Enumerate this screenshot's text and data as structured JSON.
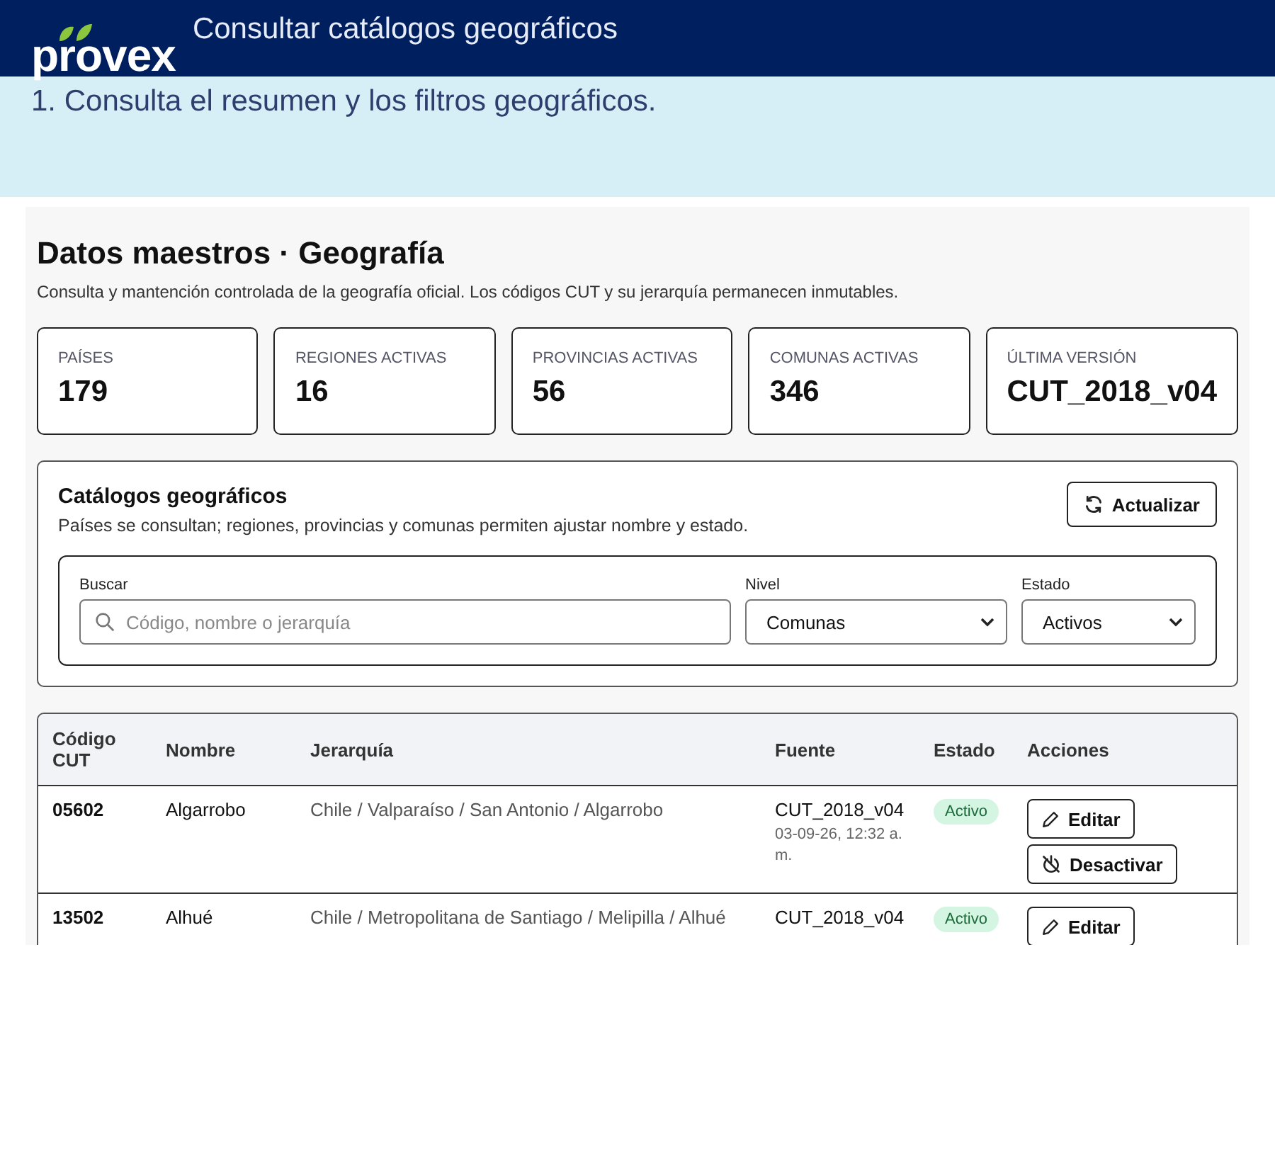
{
  "header": {
    "logo": "provex",
    "title": "Consultar catálogos geográficos"
  },
  "step": {
    "text": "1. Consulta el resumen y los filtros geográficos."
  },
  "page": {
    "title": "Datos maestros · Geografía",
    "subtitle": "Consulta y mantención controlada de la geografía oficial. Los códigos CUT y su jerarquía permanecen inmutables."
  },
  "stats": [
    {
      "label": "PAÍSES",
      "value": "179"
    },
    {
      "label": "REGIONES ACTIVAS",
      "value": "16"
    },
    {
      "label": "PROVINCIAS ACTIVAS",
      "value": "56"
    },
    {
      "label": "COMUNAS ACTIVAS",
      "value": "346"
    },
    {
      "label": "ÚLTIMA VERSIÓN",
      "value": "CUT_2018_v04"
    }
  ],
  "catalogs": {
    "title": "Catálogos geográficos",
    "subtitle": "Países se consultan; regiones, provincias y comunas permiten ajustar nombre y estado.",
    "refresh_button": "Actualizar",
    "filters": {
      "search_label": "Buscar",
      "search_placeholder": "Código, nombre o jerarquía",
      "level_label": "Nivel",
      "level_value": "Comunas",
      "status_label": "Estado",
      "status_value": "Activos"
    }
  },
  "table": {
    "columns": [
      "Código CUT",
      "Nombre",
      "Jerarquía",
      "Fuente",
      "Estado",
      "Acciones"
    ],
    "rows": [
      {
        "code": "05602",
        "name": "Algarrobo",
        "hierarchy": "Chile / Valparaíso / San Antonio / Algarrobo",
        "source": "CUT_2018_v04",
        "date": "03-09-26, 12:32 a. m.",
        "status": "Activo",
        "active": true,
        "actions": [
          {
            "kind": "edit",
            "label": "Editar"
          },
          {
            "kind": "deactivate",
            "label": "Desactivar"
          }
        ]
      },
      {
        "code": "13502",
        "name": "Alhué",
        "hierarchy": "Chile / Metropolitana de Santiago / Melipilla / Alhué",
        "source": "CUT_2018_v04",
        "status": "Activo",
        "active": true,
        "actions": [
          {
            "kind": "edit",
            "label": "Editar"
          }
        ]
      }
    ]
  }
}
